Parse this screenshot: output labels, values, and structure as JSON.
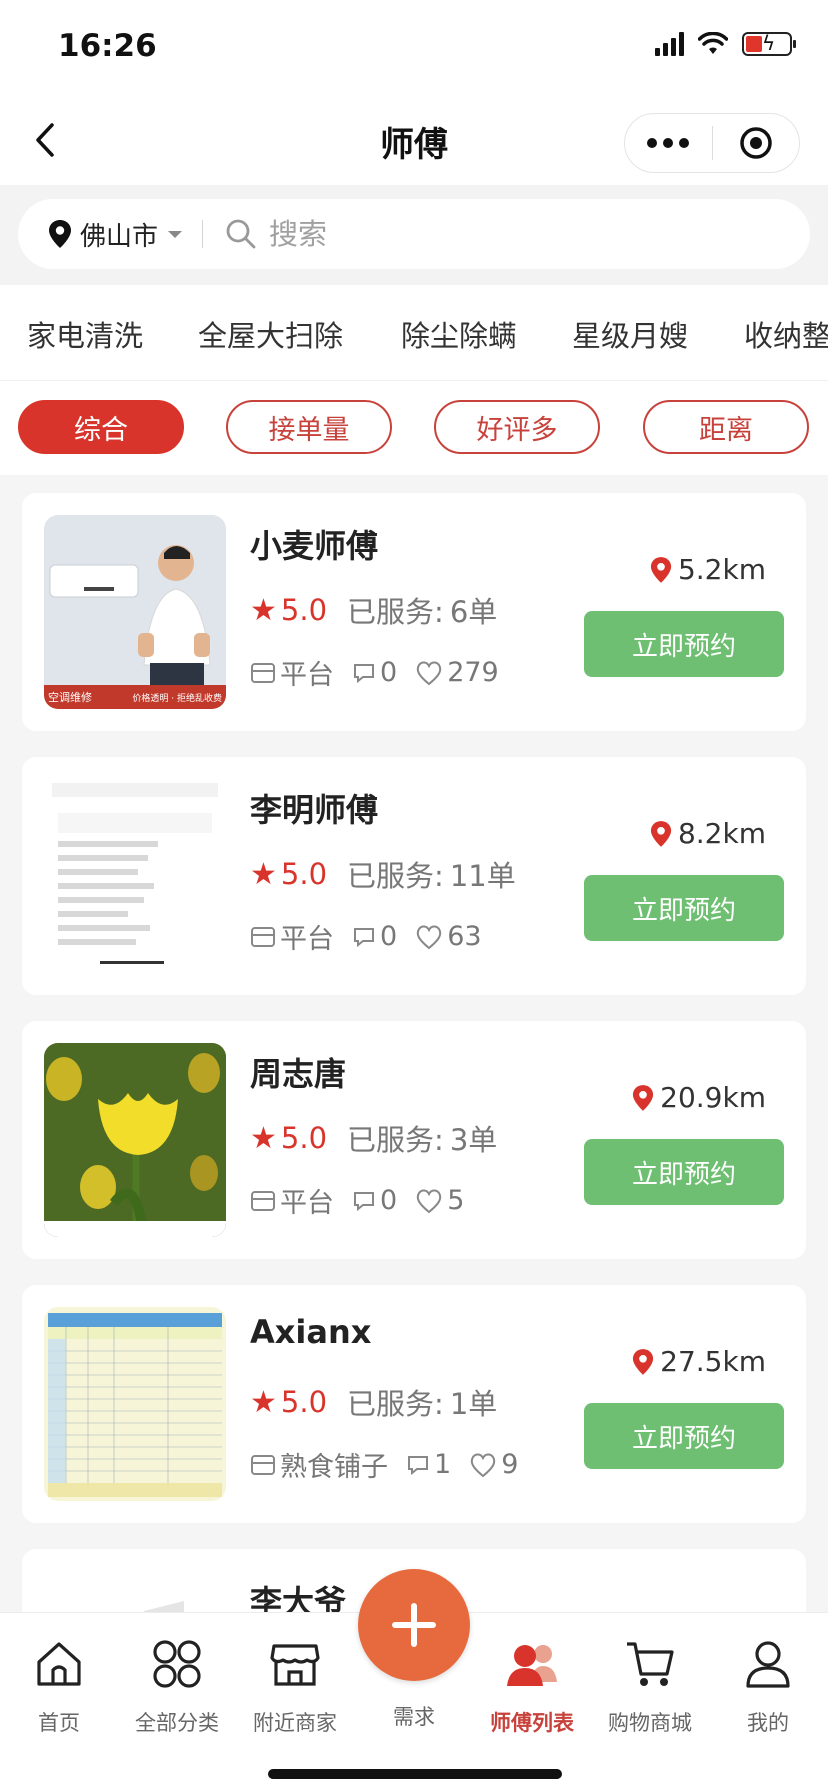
{
  "status": {
    "time": "16:26"
  },
  "nav": {
    "title": "师傅"
  },
  "search": {
    "city": "佛山市",
    "placeholder": "搜索"
  },
  "categories": [
    "家电清洗",
    "全屋大扫除",
    "除尘除螨",
    "星级月嫂",
    "收纳整"
  ],
  "filters": [
    "综合",
    "接单量",
    "好评多",
    "距离"
  ],
  "common": {
    "book_label": "立即预约",
    "served_label": "已服务:"
  },
  "masters": [
    {
      "name": "小麦师傅",
      "rating": "5.0",
      "served": "6单",
      "source": "平台",
      "comments": "0",
      "likes": "279",
      "distance": "5.2km",
      "thumb_caption_left": "空调维修",
      "thumb_caption_right": "价格透明 · 拒绝乱收费"
    },
    {
      "name": "李明师傅",
      "rating": "5.0",
      "served": "11单",
      "source": "平台",
      "comments": "0",
      "likes": "63",
      "distance": "8.2km"
    },
    {
      "name": "周志唐",
      "rating": "5.0",
      "served": "3单",
      "source": "平台",
      "comments": "0",
      "likes": "5",
      "distance": "20.9km"
    },
    {
      "name": "Axianx",
      "rating": "5.0",
      "served": "1单",
      "source": "熟食铺子",
      "comments": "1",
      "likes": "9",
      "distance": "27.5km"
    },
    {
      "name": "李大爷"
    }
  ],
  "tabs": [
    "首页",
    "全部分类",
    "附近商家",
    "需求",
    "师傅列表",
    "购物商城",
    "我的"
  ],
  "colors": {
    "accent": "#d9342b",
    "book_green": "#6fbf73",
    "fab_orange": "#e66a3d"
  }
}
